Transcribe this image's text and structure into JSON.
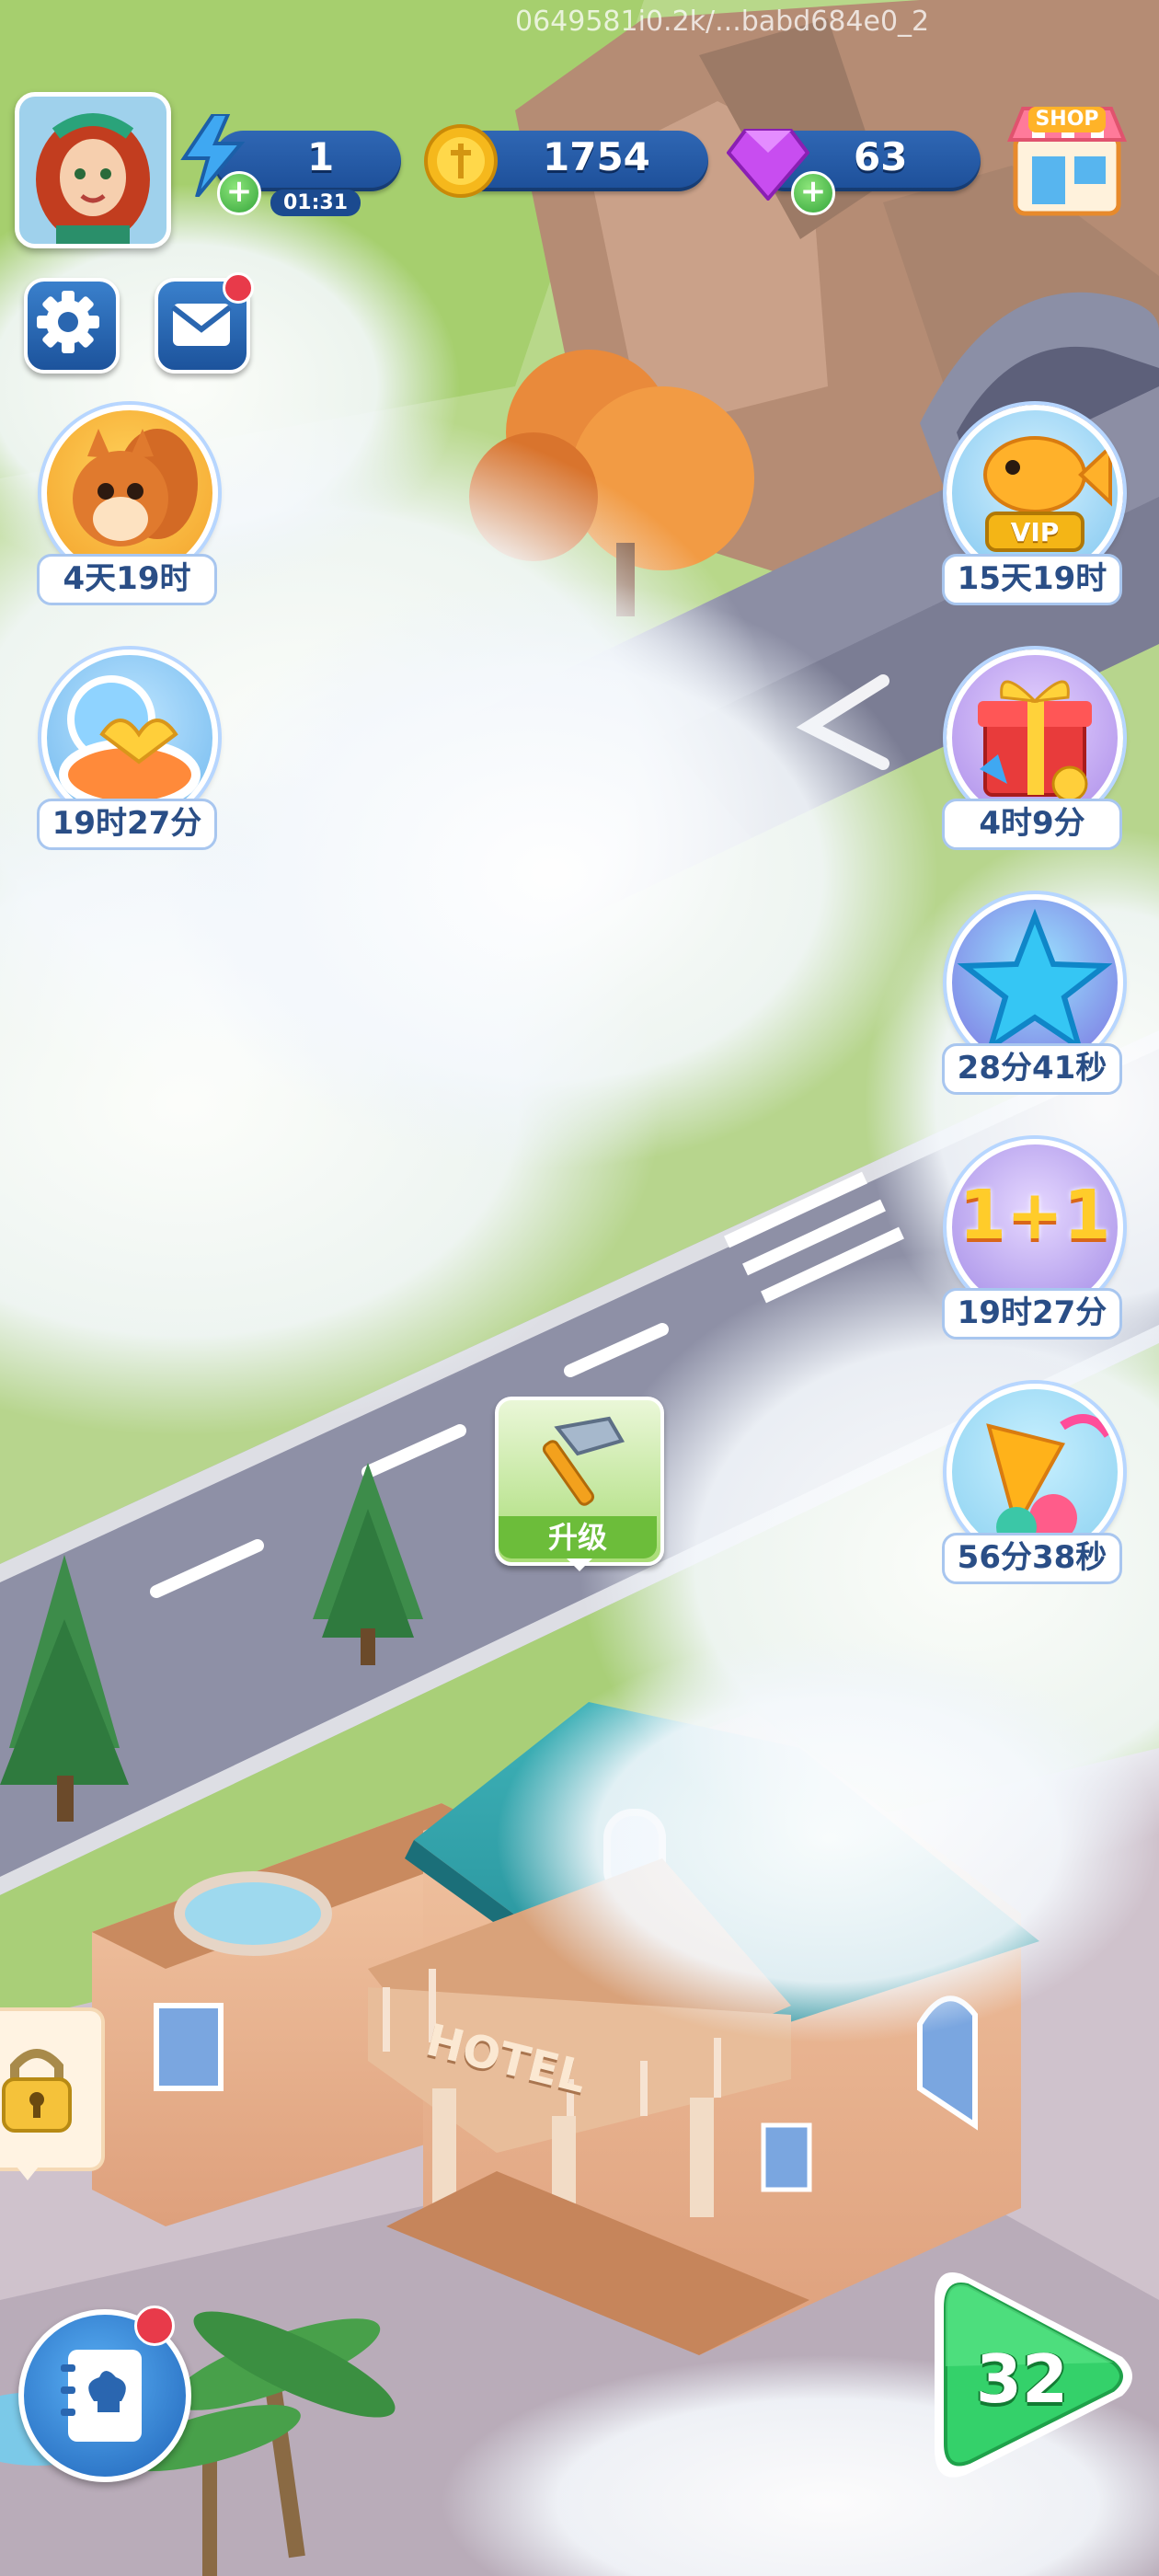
{
  "hud": {
    "energy": {
      "value": "1",
      "timer": "01:31"
    },
    "coins": {
      "value": "1754"
    },
    "gems": {
      "value": "63"
    },
    "shop_label": "SHOP"
  },
  "events_left": [
    {
      "name": "squirrel-event",
      "label": "4天19时"
    },
    {
      "name": "beach-event",
      "label": "19时27分"
    }
  ],
  "events_right": [
    {
      "name": "vip-event",
      "label": "15天19时",
      "badge": "VIP"
    },
    {
      "name": "gift-event",
      "label": "4时9分"
    },
    {
      "name": "star-event",
      "label": "28分41秒"
    },
    {
      "name": "one-plus-one-event",
      "label": "19时27分",
      "badge": "1+1"
    },
    {
      "name": "party-event",
      "label": "56分38秒"
    }
  ],
  "upgrade": {
    "label": "升级"
  },
  "building": {
    "sign": "HOTEL"
  },
  "play": {
    "level": "32"
  },
  "watermark": "0649581i0.2k/...babd684e0_2"
}
